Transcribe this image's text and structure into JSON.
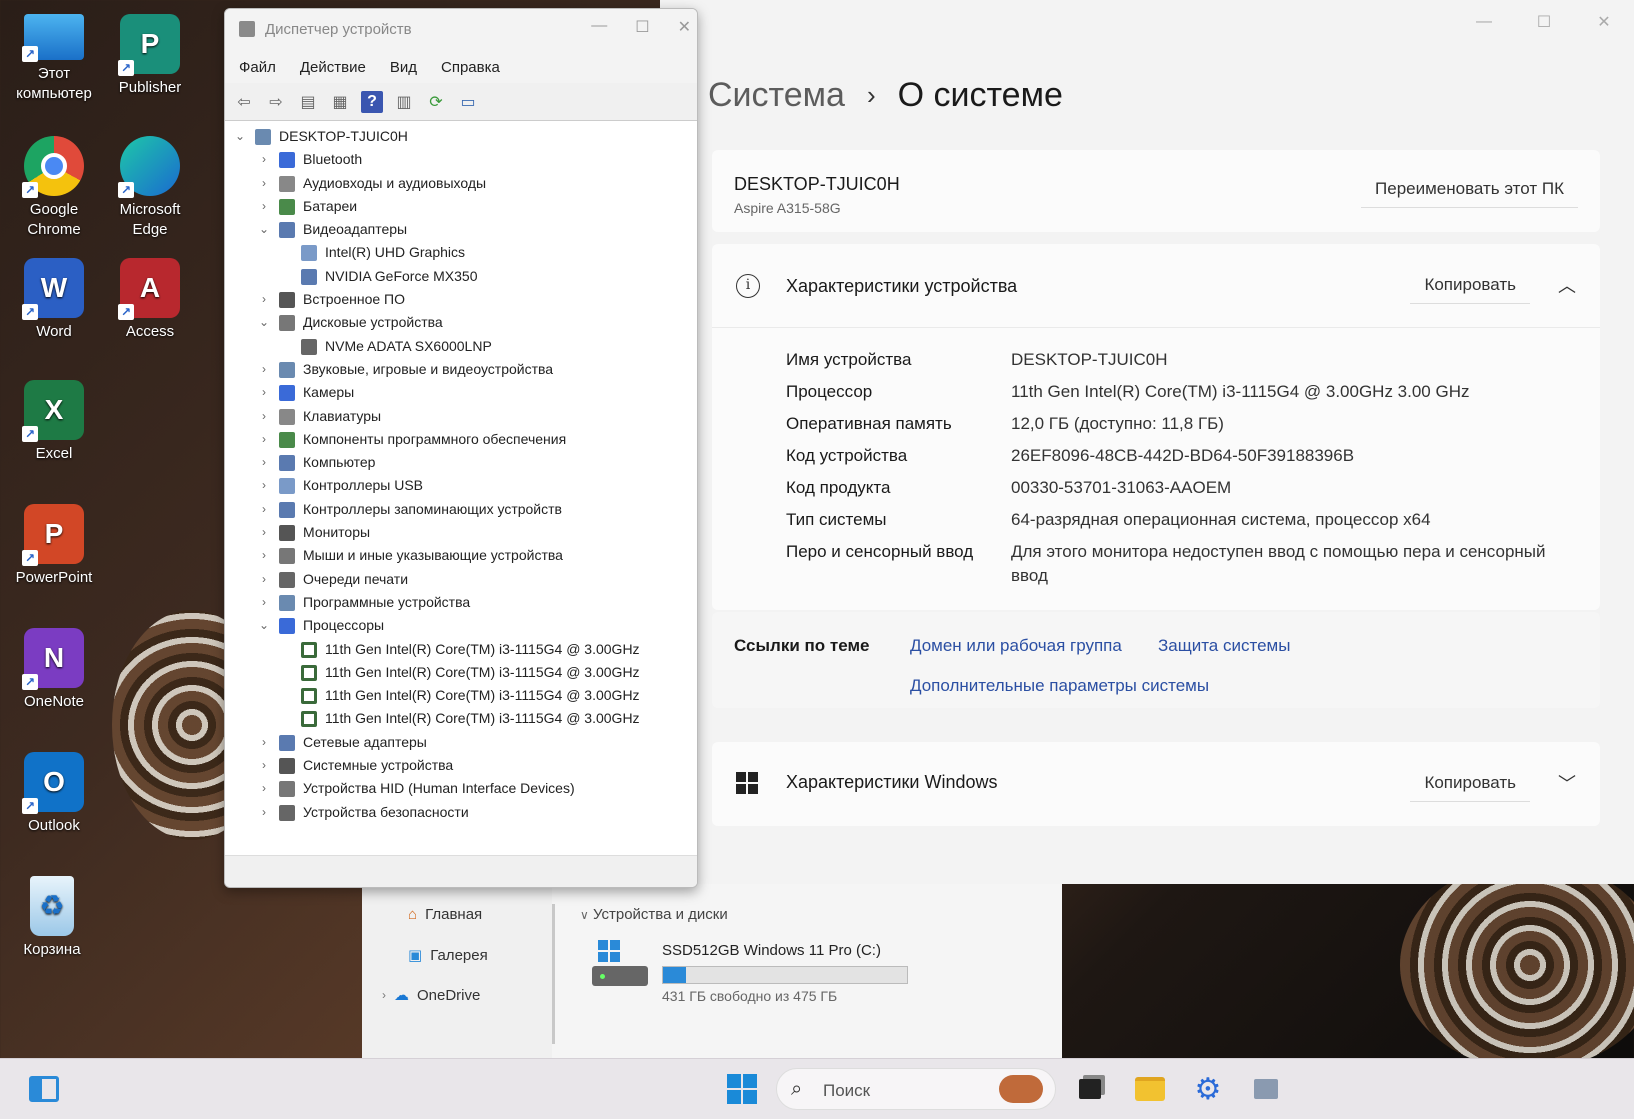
{
  "desktop": {
    "icons": [
      {
        "label": "Этот компьютер",
        "icon": "monitor-icon",
        "color": "#2a8ad8"
      },
      {
        "label": "Publisher",
        "icon": "publisher-icon",
        "color": "#1a8f7a"
      },
      {
        "label": "Google Chrome",
        "icon": "chrome-icon",
        "color": "#e04a3a"
      },
      {
        "label": "Microsoft Edge",
        "icon": "edge-icon",
        "color": "#1a8ad0"
      },
      {
        "label": "Word",
        "icon": "word-icon",
        "color": "#2b5fc4"
      },
      {
        "label": "Access",
        "icon": "access-icon",
        "color": "#b8282e"
      },
      {
        "label": "Excel",
        "icon": "excel-icon",
        "color": "#1e7a45"
      },
      {
        "label": "PowerPoint",
        "icon": "powerpoint-icon",
        "color": "#d24726"
      },
      {
        "label": "OneNote",
        "icon": "onenote-icon",
        "color": "#7b3cc2"
      },
      {
        "label": "Outlook",
        "icon": "outlook-icon",
        "color": "#1072c8"
      },
      {
        "label": "Корзина",
        "icon": "recycle-bin-icon",
        "color": "#7ab8e0"
      }
    ],
    "icon_letters": {
      "publisher": "P",
      "word": "W",
      "access": "A",
      "excel": "X",
      "powerpoint": "P",
      "onenote": "N",
      "outlook": "O"
    }
  },
  "settings": {
    "breadcrumb_parent": "Система",
    "breadcrumb_separator": "›",
    "breadcrumb_current": "О системе",
    "pc_name": "DESKTOP-TJUIC0H",
    "pc_model": "Aspire A315-58G",
    "rename_button": "Переименовать этот ПК",
    "device_specs_title": "Характеристики устройства",
    "copy_button": "Копировать",
    "specs": [
      {
        "key": "Имя устройства",
        "value": "DESKTOP-TJUIC0H"
      },
      {
        "key": "Процессор",
        "value": "11th Gen Intel(R) Core(TM) i3-1115G4 @ 3.00GHz   3.00 GHz"
      },
      {
        "key": "Оперативная память",
        "value": "12,0 ГБ (доступно: 11,8 ГБ)"
      },
      {
        "key": "Код устройства",
        "value": "26EF8096-48CB-442D-BD64-50F39188396B"
      },
      {
        "key": "Код продукта",
        "value": "00330-53701-31063-AAOEM"
      },
      {
        "key": "Тип системы",
        "value": "64-разрядная операционная система, процессор x64"
      },
      {
        "key": "Перо и сенсорный ввод",
        "value": "Для этого монитора недоступен ввод с помощью пера и сенсорный ввод"
      }
    ],
    "related_links_title": "Ссылки по теме",
    "link_domain": "Домен или рабочая группа",
    "link_protection": "Защита системы",
    "link_advanced": "Дополнительные параметры системы",
    "windows_specs_title": "Характеристики Windows",
    "windows_copy_button": "Копировать"
  },
  "device_manager": {
    "title": "Диспетчер устройств",
    "menu": [
      "Файл",
      "Действие",
      "Вид",
      "Справка"
    ],
    "tree": [
      {
        "label": "DESKTOP-TJUIC0H",
        "level": 0,
        "exp": "v"
      },
      {
        "label": "Bluetooth",
        "level": 1,
        "exp": ">"
      },
      {
        "label": "Аудиовходы и аудиовыходы",
        "level": 1,
        "exp": ">"
      },
      {
        "label": "Батареи",
        "level": 1,
        "exp": ">"
      },
      {
        "label": "Видеоадаптеры",
        "level": 1,
        "exp": "v"
      },
      {
        "label": "Intel(R) UHD Graphics",
        "level": 2,
        "exp": ""
      },
      {
        "label": "NVIDIA GeForce MX350",
        "level": 2,
        "exp": ""
      },
      {
        "label": "Встроенное ПО",
        "level": 1,
        "exp": ">"
      },
      {
        "label": "Дисковые устройства",
        "level": 1,
        "exp": "v"
      },
      {
        "label": "NVMe ADATA SX6000LNP",
        "level": 2,
        "exp": ""
      },
      {
        "label": "Звуковые, игровые и видеоустройства",
        "level": 1,
        "exp": ">"
      },
      {
        "label": "Камеры",
        "level": 1,
        "exp": ">"
      },
      {
        "label": "Клавиатуры",
        "level": 1,
        "exp": ">"
      },
      {
        "label": "Компоненты программного обеспечения",
        "level": 1,
        "exp": ">"
      },
      {
        "label": "Компьютер",
        "level": 1,
        "exp": ">"
      },
      {
        "label": "Контроллеры USB",
        "level": 1,
        "exp": ">"
      },
      {
        "label": "Контроллеры запоминающих устройств",
        "level": 1,
        "exp": ">"
      },
      {
        "label": "Мониторы",
        "level": 1,
        "exp": ">"
      },
      {
        "label": "Мыши и иные указывающие устройства",
        "level": 1,
        "exp": ">"
      },
      {
        "label": "Очереди печати",
        "level": 1,
        "exp": ">"
      },
      {
        "label": "Программные устройства",
        "level": 1,
        "exp": ">"
      },
      {
        "label": "Процессоры",
        "level": 1,
        "exp": "v"
      },
      {
        "label": "11th Gen Intel(R) Core(TM) i3-1115G4 @ 3.00GHz",
        "level": 2,
        "exp": ""
      },
      {
        "label": "11th Gen Intel(R) Core(TM) i3-1115G4 @ 3.00GHz",
        "level": 2,
        "exp": ""
      },
      {
        "label": "11th Gen Intel(R) Core(TM) i3-1115G4 @ 3.00GHz",
        "level": 2,
        "exp": ""
      },
      {
        "label": "11th Gen Intel(R) Core(TM) i3-1115G4 @ 3.00GHz",
        "level": 2,
        "exp": ""
      },
      {
        "label": "Сетевые адаптеры",
        "level": 1,
        "exp": ">"
      },
      {
        "label": "Системные устройства",
        "level": 1,
        "exp": ">"
      },
      {
        "label": "Устройства HID (Human Interface Devices)",
        "level": 1,
        "exp": ">"
      },
      {
        "label": "Устройства безопасности",
        "level": 1,
        "exp": ">"
      }
    ]
  },
  "explorer": {
    "nav_home": "Главная",
    "nav_gallery": "Галерея",
    "nav_onedrive": "OneDrive",
    "group_header": "Устройства и диски",
    "drive_name": "SSD512GB Windows 11 Pro (C:)",
    "drive_free": "431 ГБ свободно из 475 ГБ",
    "drive_used_fraction": 0.093
  },
  "taskbar": {
    "search_placeholder": "Поиск"
  },
  "colors": {
    "accent": "#2a8ad8",
    "link": "#2b4fa3"
  }
}
